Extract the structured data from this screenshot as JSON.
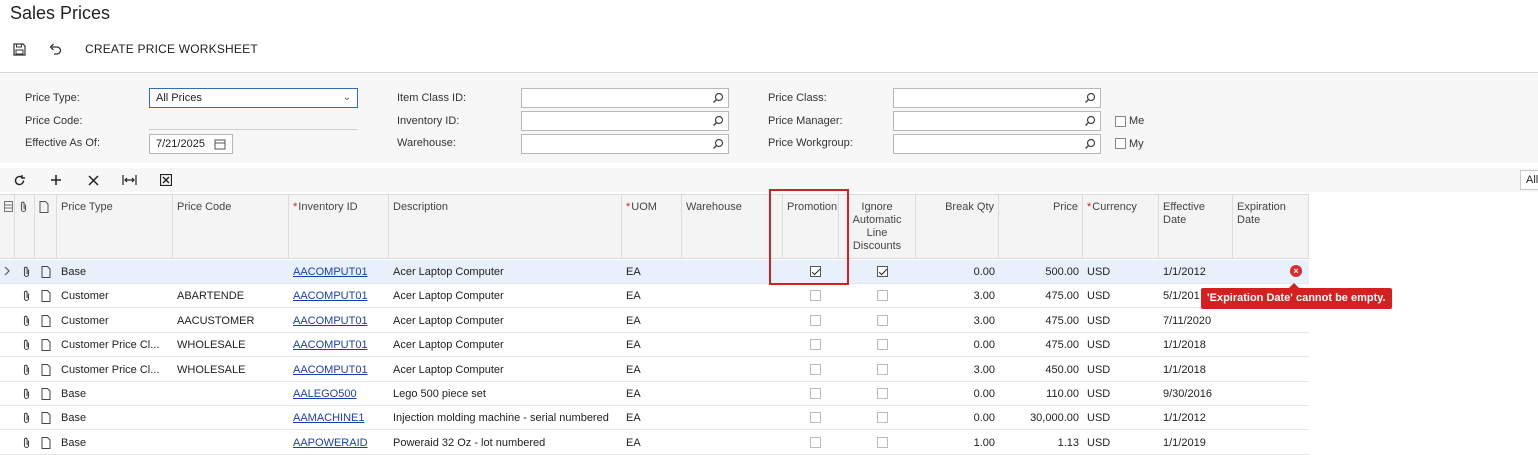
{
  "page": {
    "title": "Sales Prices"
  },
  "toolbar": {
    "create_worksheet": "CREATE PRICE WORKSHEET"
  },
  "filters": {
    "price_type_label": "Price Type:",
    "price_type_value": "All Prices",
    "price_code_label": "Price Code:",
    "effective_label": "Effective As Of:",
    "effective_value": "7/21/2025",
    "item_class_label": "Item Class ID:",
    "inventory_label": "Inventory ID:",
    "warehouse_label": "Warehouse:",
    "price_class_label": "Price Class:",
    "price_manager_label": "Price Manager:",
    "price_workgroup_label": "Price Workgroup:",
    "me_label": "Me",
    "my_label": "My"
  },
  "grid_toolbar": {
    "all_label": "All"
  },
  "columns": {
    "price_type": "Price Type",
    "price_code": "Price Code",
    "inventory_id": "Inventory ID",
    "description": "Description",
    "uom": "UOM",
    "warehouse": "Warehouse",
    "promotion": "Promotion",
    "ignore_line1": "Ignore",
    "ignore_line2": "Automatic",
    "ignore_line3": "Line",
    "ignore_line4": "Discounts",
    "break_qty": "Break Qty",
    "price": "Price",
    "currency": "Currency",
    "effective_line1": "Effective",
    "effective_line2": "Date",
    "expiration_line1": "Expiration",
    "expiration_line2": "Date"
  },
  "rows": [
    {
      "price_type": "Base",
      "price_code": "",
      "inventory_id": "AACOMPUT01",
      "description": "Acer Laptop Computer",
      "uom": "EA",
      "warehouse": "",
      "promotion": true,
      "ignore": true,
      "break_qty": "0.00",
      "price": "500.00",
      "currency": "USD",
      "effective": "1/1/2012",
      "expiration": ""
    },
    {
      "price_type": "Customer",
      "price_code": "ABARTENDE",
      "inventory_id": "AACOMPUT01",
      "description": "Acer Laptop Computer",
      "uom": "EA",
      "warehouse": "",
      "promotion": false,
      "ignore": false,
      "break_qty": "3.00",
      "price": "475.00",
      "currency": "USD",
      "effective": "5/1/201",
      "expiration": ""
    },
    {
      "price_type": "Customer",
      "price_code": "AACUSTOMER",
      "inventory_id": "AACOMPUT01",
      "description": "Acer Laptop Computer",
      "uom": "EA",
      "warehouse": "",
      "promotion": false,
      "ignore": false,
      "break_qty": "3.00",
      "price": "475.00",
      "currency": "USD",
      "effective": "7/11/2020",
      "expiration": ""
    },
    {
      "price_type": "Customer Price Cl...",
      "price_code": "WHOLESALE",
      "inventory_id": "AACOMPUT01",
      "description": "Acer Laptop Computer",
      "uom": "EA",
      "warehouse": "",
      "promotion": false,
      "ignore": false,
      "break_qty": "0.00",
      "price": "475.00",
      "currency": "USD",
      "effective": "1/1/2018",
      "expiration": ""
    },
    {
      "price_type": "Customer Price Cl...",
      "price_code": "WHOLESALE",
      "inventory_id": "AACOMPUT01",
      "description": "Acer Laptop Computer",
      "uom": "EA",
      "warehouse": "",
      "promotion": false,
      "ignore": false,
      "break_qty": "3.00",
      "price": "450.00",
      "currency": "USD",
      "effective": "1/1/2018",
      "expiration": ""
    },
    {
      "price_type": "Base",
      "price_code": "",
      "inventory_id": "AALEGO500",
      "description": "Lego 500 piece set",
      "uom": "EA",
      "warehouse": "",
      "promotion": false,
      "ignore": false,
      "break_qty": "0.00",
      "price": "110.00",
      "currency": "USD",
      "effective": "9/30/2016",
      "expiration": ""
    },
    {
      "price_type": "Base",
      "price_code": "",
      "inventory_id": "AAMACHINE1",
      "description": "Injection molding machine - serial numbered",
      "uom": "EA",
      "warehouse": "",
      "promotion": false,
      "ignore": false,
      "break_qty": "0.00",
      "price": "30,000.00",
      "currency": "USD",
      "effective": "1/1/2012",
      "expiration": ""
    },
    {
      "price_type": "Base",
      "price_code": "",
      "inventory_id": "AAPOWERAID",
      "description": "Poweraid 32 Oz - lot numbered",
      "uom": "EA",
      "warehouse": "",
      "promotion": false,
      "ignore": false,
      "break_qty": "1.00",
      "price": "1.13",
      "currency": "USD",
      "effective": "1/1/2019",
      "expiration": ""
    }
  ],
  "error": {
    "icon_glyph": "×",
    "message": "'Expiration Date' cannot be empty."
  }
}
